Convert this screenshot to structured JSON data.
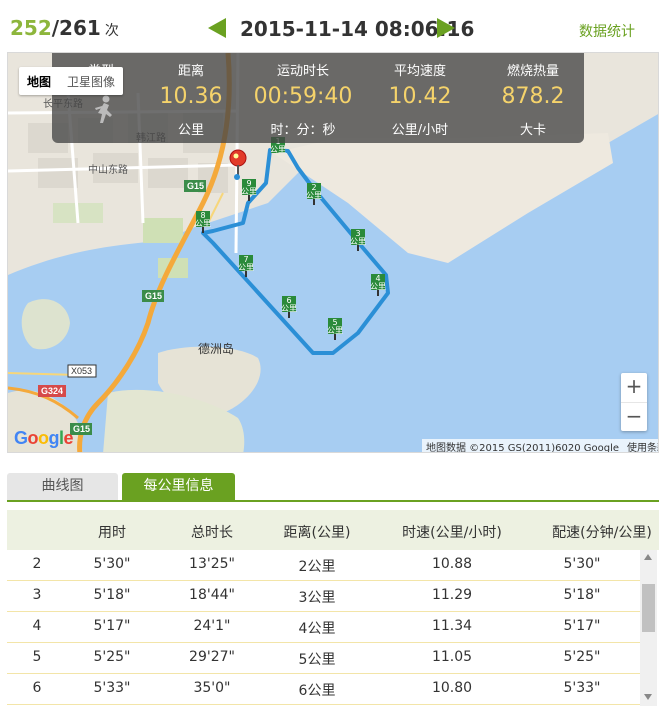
{
  "header": {
    "current_count": "252",
    "total_count": "/261",
    "count_unit": "次",
    "datetime": "2015-11-14 08:06:16",
    "stats_link": "数据统计"
  },
  "map": {
    "maptype_map": "地图",
    "maptype_satellite": "卫星图像",
    "place_label": "德洲岛",
    "road_labels": [
      "G15",
      "G15",
      "G15",
      "G324",
      "X053",
      "长平东路",
      "中山东路",
      "韩江路"
    ],
    "attribution_data": "地图数据 ©2015 GS(2011)6020 Google",
    "attribution_terms": "使用条款",
    "google_logo": "Google",
    "zoom_in": "+",
    "zoom_out": "−",
    "km_markers": [
      "2",
      "3",
      "4",
      "5",
      "6",
      "7",
      "8",
      "9",
      "1"
    ],
    "km_marker_unit": "公里",
    "route_color": "#2b8fd6",
    "water_color": "#a7cdf2"
  },
  "summary": {
    "type_label": "类型",
    "distance": {
      "label": "距离",
      "value": "10.36",
      "unit": "公里"
    },
    "duration": {
      "label": "运动时长",
      "value": "00:59:40",
      "unit": "时：分：秒"
    },
    "speed": {
      "label": "平均速度",
      "value": "10.42",
      "unit": "公里/小时"
    },
    "calories": {
      "label": "燃烧热量",
      "value": "878.2",
      "unit": "大卡"
    }
  },
  "tabs": {
    "curve": "曲线图",
    "per_km": "每公里信息"
  },
  "table": {
    "headers": [
      "",
      "用时",
      "总时长",
      "距离(公里)",
      "时速(公里/小时)",
      "配速(分钟/公里)"
    ],
    "rows": [
      [
        "2",
        "5'30\"",
        "13'25\"",
        "2公里",
        "10.88",
        "5'30\""
      ],
      [
        "3",
        "5'18\"",
        "18'44\"",
        "3公里",
        "11.29",
        "5'18\""
      ],
      [
        "4",
        "5'17\"",
        "24'1\"",
        "4公里",
        "11.34",
        "5'17\""
      ],
      [
        "5",
        "5'25\"",
        "29'27\"",
        "5公里",
        "11.05",
        "5'25\""
      ],
      [
        "6",
        "5'33\"",
        "35'0\"",
        "6公里",
        "10.80",
        "5'33\""
      ]
    ]
  },
  "colors": {
    "accent_green": "#6aa121",
    "value_yellow": "#f5d36b"
  }
}
